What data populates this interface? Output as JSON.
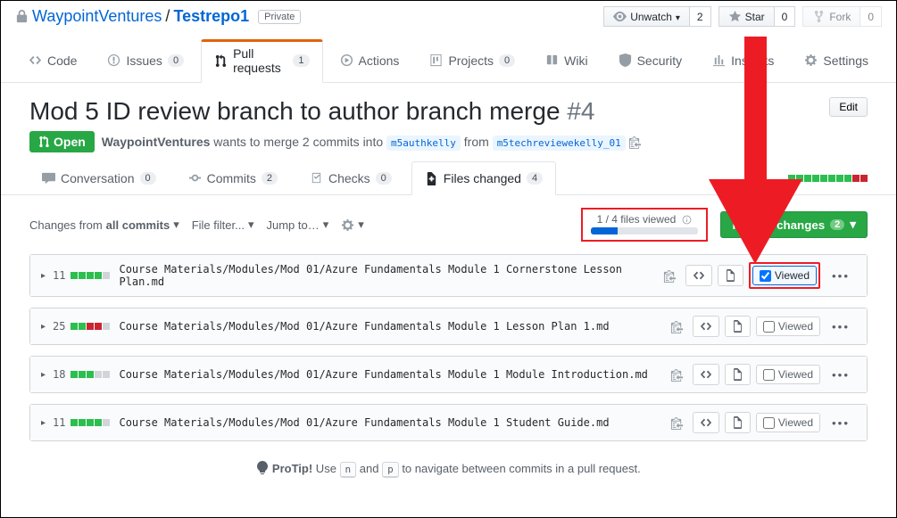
{
  "breadcrumb": {
    "owner": "WaypointVentures",
    "repo": "Testrepo1",
    "visibility": "Private"
  },
  "repo_actions": {
    "unwatch": "Unwatch",
    "unwatch_count": "2",
    "star": "Star",
    "star_count": "0",
    "fork": "Fork",
    "fork_count": "0"
  },
  "nav": {
    "code": "Code",
    "issues": "Issues",
    "issues_count": "0",
    "pulls": "Pull requests",
    "pulls_count": "1",
    "actions": "Actions",
    "projects": "Projects",
    "projects_count": "0",
    "wiki": "Wiki",
    "security": "Security",
    "insights": "Insights",
    "settings": "Settings"
  },
  "pr": {
    "title": "Mod 5 ID review branch to author branch merge",
    "number": "#4",
    "edit": "Edit",
    "state": "Open",
    "author": "WaypointVentures",
    "merge_text1": " wants to merge 2 commits into ",
    "base": "m5authkelly",
    "merge_text2": " from ",
    "head": "m5techreviewekelly_01"
  },
  "subtabs": {
    "conv": "Conversation",
    "conv_count": "0",
    "commits": "Commits",
    "commits_count": "2",
    "checks": "Checks",
    "checks_count": "0",
    "files": "Files changed",
    "files_count": "4"
  },
  "toolbar": {
    "changes_from": "Changes from",
    "all_commits": "all commits",
    "file_filter": "File filter...",
    "jump_to": "Jump to…",
    "viewed_label": "1 / 4 files viewed",
    "review": "Review changes",
    "review_count": "2"
  },
  "files": [
    {
      "stat": "11",
      "bars": [
        "g",
        "g",
        "g",
        "g",
        "n"
      ],
      "path": "Course Materials/Modules/Mod 01/Azure Fundamentals Module 1 Cornerstone Lesson Plan.md",
      "viewed": true
    },
    {
      "stat": "25",
      "bars": [
        "g",
        "g",
        "r",
        "r",
        "n"
      ],
      "path": "Course Materials/Modules/Mod 01/Azure Fundamentals Module 1 Lesson Plan 1.md",
      "viewed": false
    },
    {
      "stat": "18",
      "bars": [
        "g",
        "g",
        "g",
        "n",
        "n"
      ],
      "path": "Course Materials/Modules/Mod 01/Azure Fundamentals Module 1 Module Introduction.md",
      "viewed": false
    },
    {
      "stat": "11",
      "bars": [
        "g",
        "g",
        "g",
        "g",
        "n"
      ],
      "path": "Course Materials/Modules/Mod 01/Azure Fundamentals Module 1 Student Guide.md",
      "viewed": false
    }
  ],
  "viewed_label": "Viewed",
  "protip": {
    "bold": "ProTip!",
    "t1": " Use ",
    "k1": "n",
    "t2": " and ",
    "k2": "p",
    "t3": " to navigate between commits in a pull request."
  }
}
